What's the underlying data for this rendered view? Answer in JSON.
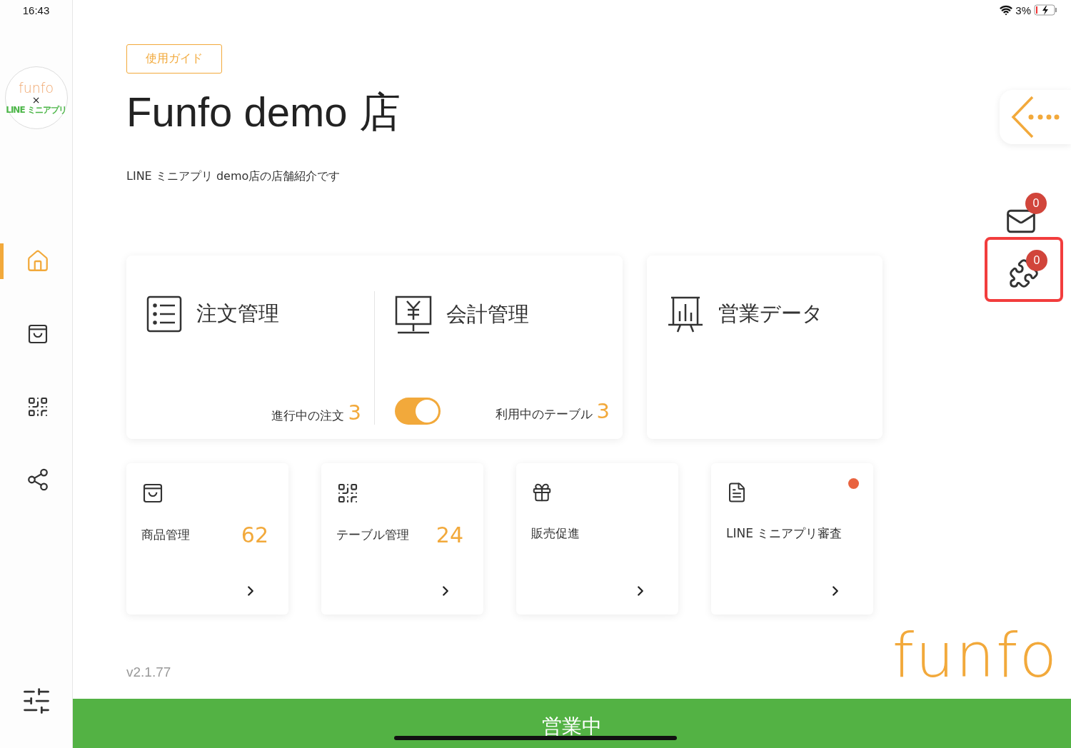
{
  "status_bar": {
    "time": "16:43",
    "battery": "3%"
  },
  "sidebar": {
    "logo": {
      "brand": "funfo",
      "cross": "×",
      "partner": "LINE ミニアプリ"
    },
    "items": [
      {
        "kind": "home",
        "selected": true
      },
      {
        "kind": "bag",
        "selected": false
      },
      {
        "kind": "qr",
        "selected": false
      },
      {
        "kind": "network",
        "selected": false
      }
    ]
  },
  "guide_button": "使用ガイド",
  "store": {
    "title": "Funfo demo 店",
    "description": "LINE ミニアプリ demo店の店舗紹介です"
  },
  "main_cards": [
    {
      "kind": "order",
      "title": "注文管理",
      "caption": "進行中の注文",
      "count": "3"
    },
    {
      "kind": "accounting",
      "title": "会計管理",
      "toggle_on": true,
      "caption": "利用中のテーブル",
      "count": "3"
    },
    {
      "kind": "sales",
      "title": "営業データ"
    }
  ],
  "tiles": [
    {
      "kind": "bag",
      "label": "商品管理",
      "count": "62",
      "unread": false
    },
    {
      "kind": "qr",
      "label": "テーブル管理",
      "count": "24",
      "unread": false
    },
    {
      "kind": "gift",
      "label": "販売促進",
      "unread": false
    },
    {
      "kind": "doc",
      "label": "LINE ミニアプリ審査",
      "unread": true
    }
  ],
  "version": "v2.1.77",
  "brand": "funfo",
  "right_panel": {
    "mail_badge": "0",
    "plugin_badge": "0",
    "plugin_highlighted": true
  },
  "open_status": "営業中"
}
